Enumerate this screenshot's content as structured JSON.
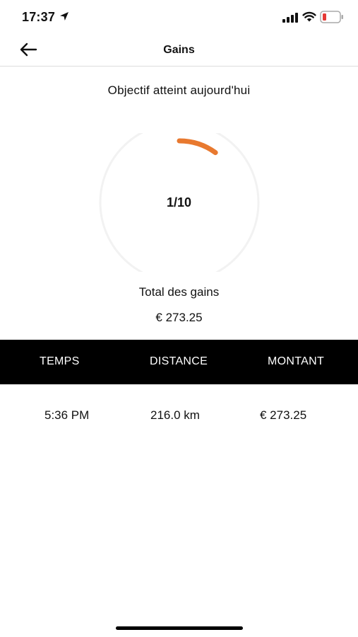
{
  "status_bar": {
    "time": "17:37"
  },
  "header": {
    "title": "Gains"
  },
  "goal": {
    "label": "Objectif atteint aujourd'hui",
    "progress_text": "1/10",
    "progress_fraction": 0.1,
    "accent_color": "#e8792f"
  },
  "total": {
    "label": "Total des gains",
    "value": "€ 273.25"
  },
  "table": {
    "headers": [
      "TEMPS",
      "DISTANCE",
      "MONTANT"
    ],
    "rows": [
      [
        "5:36 PM",
        "216.0 km",
        "€ 273.25"
      ]
    ]
  }
}
